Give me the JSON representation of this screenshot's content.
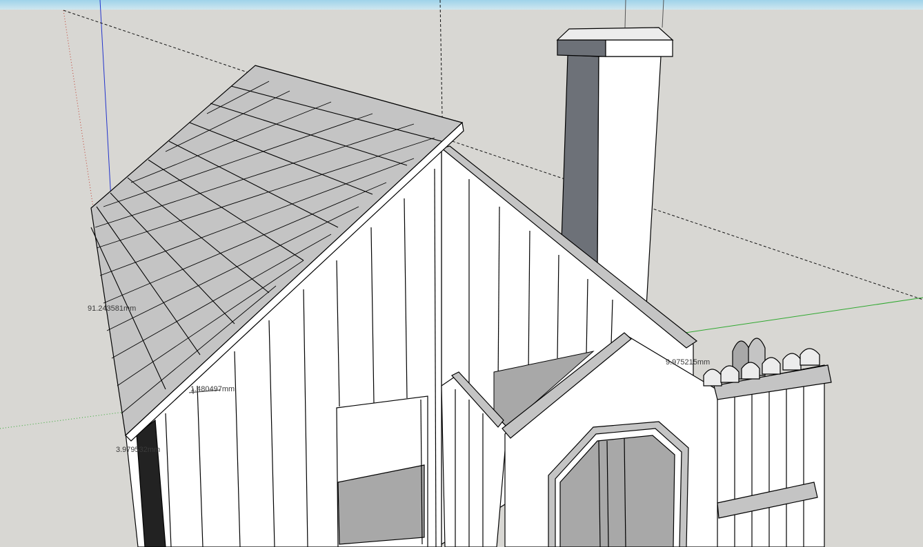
{
  "app": {
    "window_kind": "3D modeling viewport",
    "scene_subject": "house model",
    "background_color": "#d8d7d3",
    "sky_color": "#a8d6ea"
  },
  "axes": {
    "red_color": "#c0392b",
    "green_color": "#2ea82e",
    "blue_color": "#2233cc"
  },
  "dimensions": [
    {
      "label": "91.243581mm"
    },
    {
      "label": "1.480497mm"
    },
    {
      "label": "3.979532mm"
    },
    {
      "label": "9.975215mm"
    }
  ],
  "materials": {
    "face_white": "#ffffff",
    "face_light_gray": "#c4c4c4",
    "face_gray": "#a8a8a8",
    "face_dark_gray": "#6d7178",
    "edge_color": "#000000"
  }
}
